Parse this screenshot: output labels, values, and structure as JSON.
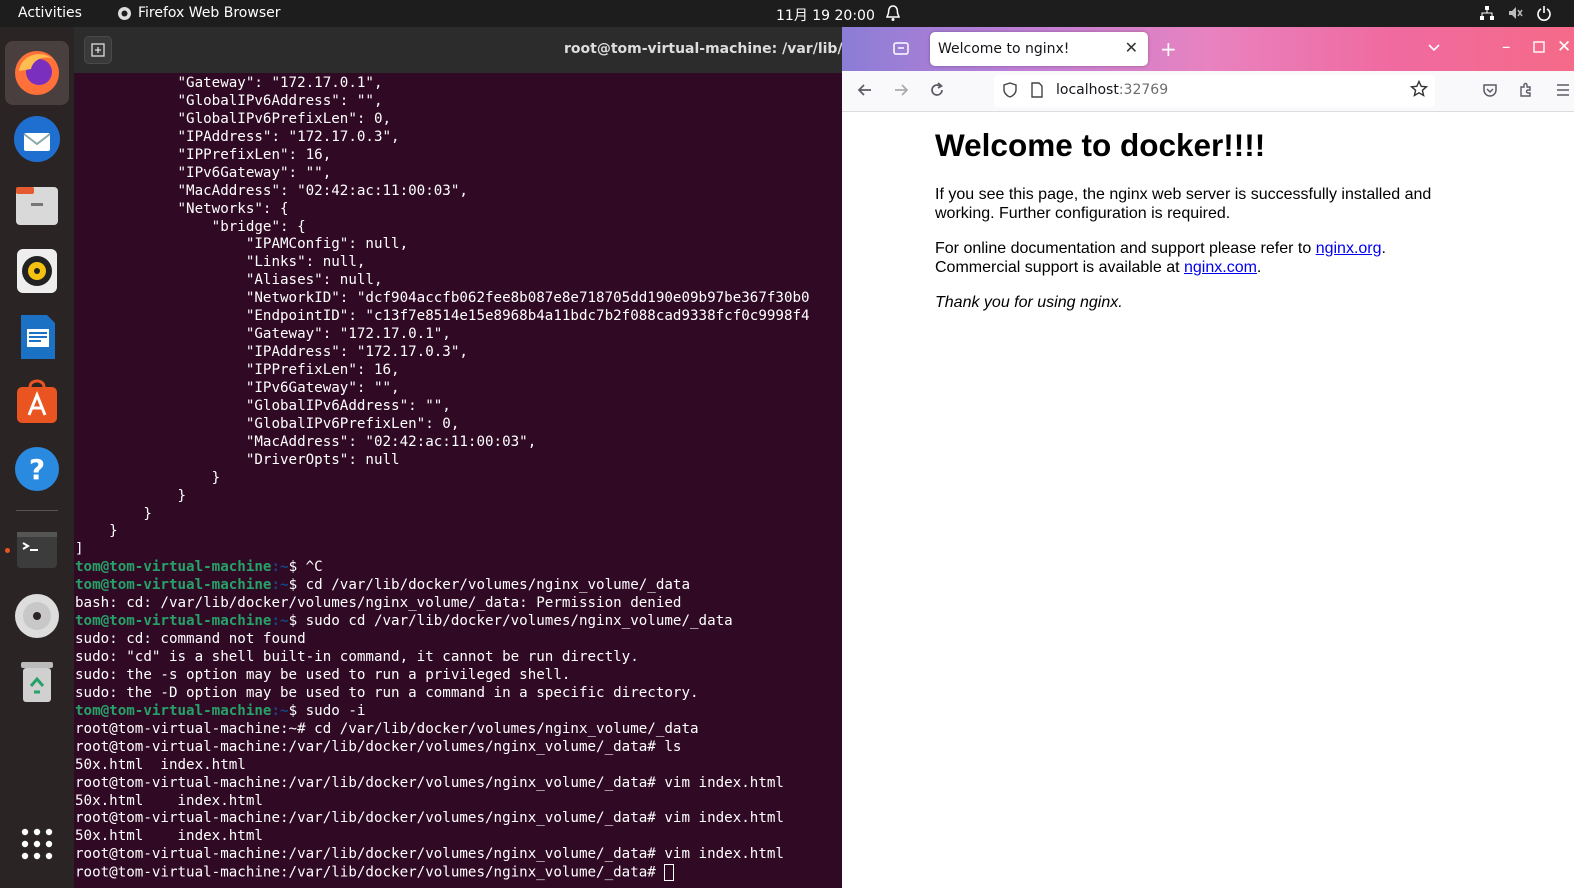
{
  "topbar": {
    "activities": "Activities",
    "app_name": "Firefox Web Browser",
    "clock": "11月 19  20:00"
  },
  "dock": {
    "items": [
      "firefox-icon",
      "thunderbird-icon",
      "files-icon",
      "rhythmbox-icon",
      "writer-icon",
      "software-icon",
      "help-icon",
      "terminal-icon",
      "disc-icon",
      "trash-icon",
      "app-grid-icon"
    ]
  },
  "terminal": {
    "title": "root@tom-virtual-machine: /var/lib/docker/volumes/nginx_volume/_data",
    "lines": [
      {
        "t": "            \"Gateway\": \"172.17.0.1\","
      },
      {
        "t": "            \"GlobalIPv6Address\": \"\","
      },
      {
        "t": "            \"GlobalIPv6PrefixLen\": 0,"
      },
      {
        "t": "            \"IPAddress\": \"172.17.0.3\","
      },
      {
        "t": "            \"IPPrefixLen\": 16,"
      },
      {
        "t": "            \"IPv6Gateway\": \"\","
      },
      {
        "t": "            \"MacAddress\": \"02:42:ac:11:00:03\","
      },
      {
        "t": "            \"Networks\": {"
      },
      {
        "t": "                \"bridge\": {"
      },
      {
        "t": "                    \"IPAMConfig\": null,"
      },
      {
        "t": "                    \"Links\": null,"
      },
      {
        "t": "                    \"Aliases\": null,"
      },
      {
        "t": "                    \"NetworkID\": \"dcf904accfb062fee8b087e8e718705dd190e09b97be367f30b0"
      },
      {
        "t": "                    \"EndpointID\": \"c13f7e8514e15e8968b4a11bdc7b2f088cad9338fcf0c9998f4"
      },
      {
        "t": "                    \"Gateway\": \"172.17.0.1\","
      },
      {
        "t": "                    \"IPAddress\": \"172.17.0.3\","
      },
      {
        "t": "                    \"IPPrefixLen\": 16,"
      },
      {
        "t": "                    \"IPv6Gateway\": \"\","
      },
      {
        "t": "                    \"GlobalIPv6Address\": \"\","
      },
      {
        "t": "                    \"GlobalIPv6PrefixLen\": 0,"
      },
      {
        "t": "                    \"MacAddress\": \"02:42:ac:11:00:03\","
      },
      {
        "t": "                    \"DriverOpts\": null"
      },
      {
        "t": "                }"
      },
      {
        "t": "            }"
      },
      {
        "t": "        }"
      },
      {
        "t": "    }"
      },
      {
        "t": "]"
      },
      {
        "p": "tom@tom-virtual-machine",
        "s": ":~",
        "t": "$ ^C"
      },
      {
        "p": "tom@tom-virtual-machine",
        "s": ":~",
        "t": "$ cd /var/lib/docker/volumes/nginx_volume/_data"
      },
      {
        "t": "bash: cd: /var/lib/docker/volumes/nginx_volume/_data: Permission denied"
      },
      {
        "p": "tom@tom-virtual-machine",
        "s": ":~",
        "t": "$ sudo cd /var/lib/docker/volumes/nginx_volume/_data"
      },
      {
        "t": "sudo: cd: command not found"
      },
      {
        "t": "sudo: \"cd\" is a shell built-in command, it cannot be run directly."
      },
      {
        "t": "sudo: the -s option may be used to run a privileged shell."
      },
      {
        "t": "sudo: the -D option may be used to run a command in a specific directory."
      },
      {
        "p": "tom@tom-virtual-machine",
        "s": ":~",
        "t": "$ sudo -i"
      },
      {
        "t": "root@tom-virtual-machine:~# cd /var/lib/docker/volumes/nginx_volume/_data"
      },
      {
        "t": "root@tom-virtual-machine:/var/lib/docker/volumes/nginx_volume/_data# ls"
      },
      {
        "t": "50x.html  index.html"
      },
      {
        "t": "root@tom-virtual-machine:/var/lib/docker/volumes/nginx_volume/_data# vim index.html"
      },
      {
        "t": "50x.html    index.html"
      },
      {
        "t": "root@tom-virtual-machine:/var/lib/docker/volumes/nginx_volume/_data# vim index.html"
      },
      {
        "t": "50x.html    index.html"
      },
      {
        "t": "root@tom-virtual-machine:/var/lib/docker/volumes/nginx_volume/_data# vim index.html"
      },
      {
        "t": "root@tom-virtual-machine:/var/lib/docker/volumes/nginx_volume/_data# ",
        "cursor": true
      }
    ]
  },
  "browser": {
    "tab_title": "Welcome to nginx!",
    "url_host": "localhost",
    "url_port": ":32769",
    "page": {
      "heading": "Welcome to docker!!!!",
      "p1": "If you see this page, the nginx web server is successfully installed and working. Further configuration is required.",
      "p2_pre": "For online documentation and support please refer to ",
      "p2_link1": "nginx.org",
      "p2_mid": ".",
      "p2_line2": "Commercial support is available at ",
      "p2_link2": "nginx.com",
      "p2_end": ".",
      "p3": "Thank you for using nginx."
    }
  }
}
